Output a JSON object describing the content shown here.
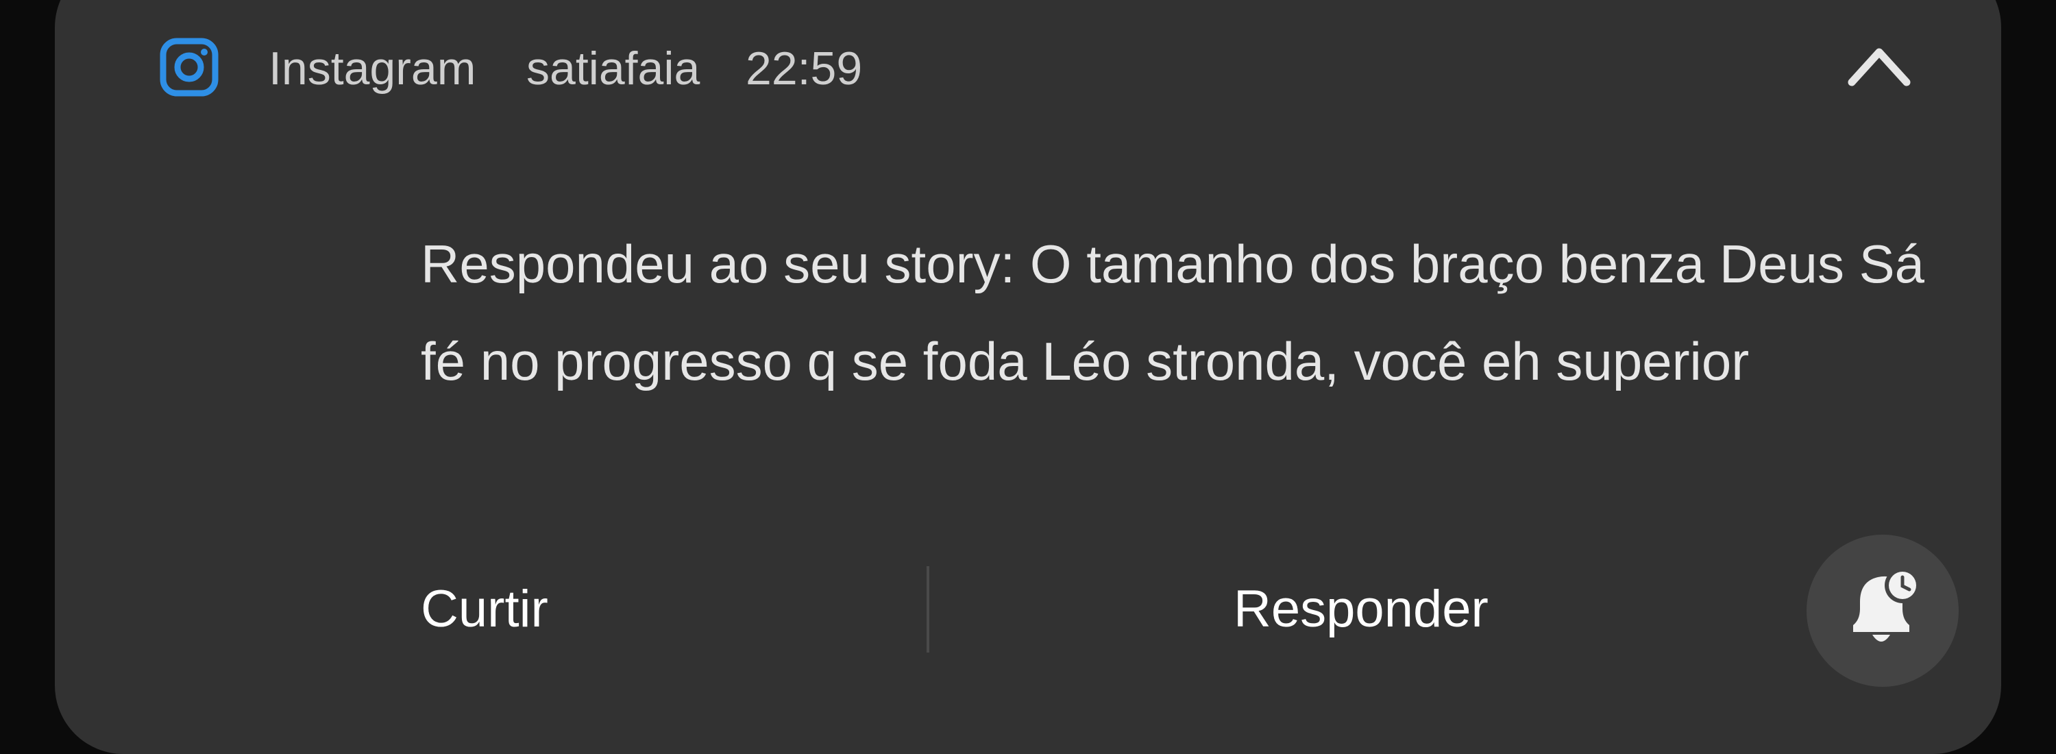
{
  "notification": {
    "app_name": "Instagram",
    "sender": "satiafaia",
    "time": "22:59",
    "message": "Respondeu ao seu story: O tamanho dos braço benza Deus Sá fé no progresso q se foda Léo stronda, você eh superior",
    "actions": {
      "like_label": "Curtir",
      "reply_label": "Responder"
    },
    "icons": {
      "app": "instagram-icon",
      "collapse": "chevron-up-icon",
      "snooze": "bell-snooze-icon"
    },
    "colors": {
      "card_background": "#323232",
      "app_icon": "#2e8fe6",
      "text_primary": "#e6e6e6",
      "text_secondary": "#cfcfcf"
    }
  }
}
